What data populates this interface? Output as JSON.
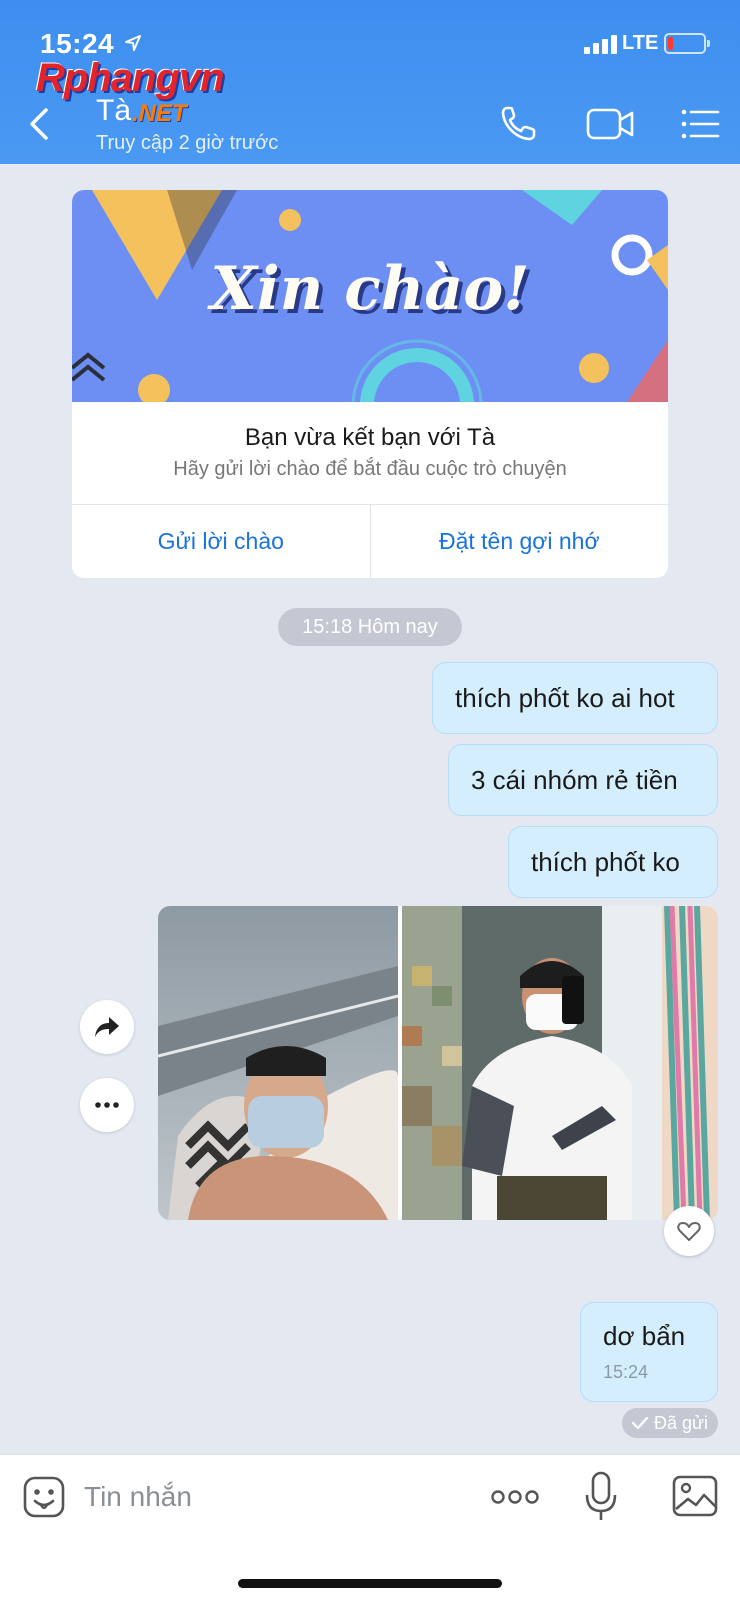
{
  "status_bar": {
    "time": "15:24",
    "network": "LTE"
  },
  "watermark": {
    "main": "Rphangvn",
    "sub": ".NET"
  },
  "header": {
    "contact_name": "Tà",
    "last_seen": "Truy cập 2 giờ trước"
  },
  "welcome_card": {
    "banner_text": "Xin chào!",
    "title": "Bạn vừa kết bạn với Tà",
    "subtitle": "Hãy gửi lời chào để bắt đầu cuộc trò chuyện",
    "button_left": "Gửi lời chào",
    "button_right": "Đặt tên gợi nhớ"
  },
  "time_separator": "15:18 Hôm nay",
  "messages": [
    {
      "text": "thích phốt ko ai hot"
    },
    {
      "text": "3 cái nhóm rẻ tiền"
    },
    {
      "text": "thích phốt ko"
    },
    {
      "text": "dơ bẩn",
      "time": "15:24"
    }
  ],
  "sent_status": "Đã gửi",
  "input": {
    "placeholder": "Tin nhắn"
  },
  "colors": {
    "header": "#4a99f2",
    "bubble": "#d4eefd",
    "accent": "#1a73d9",
    "background": "#e4e8f1"
  }
}
